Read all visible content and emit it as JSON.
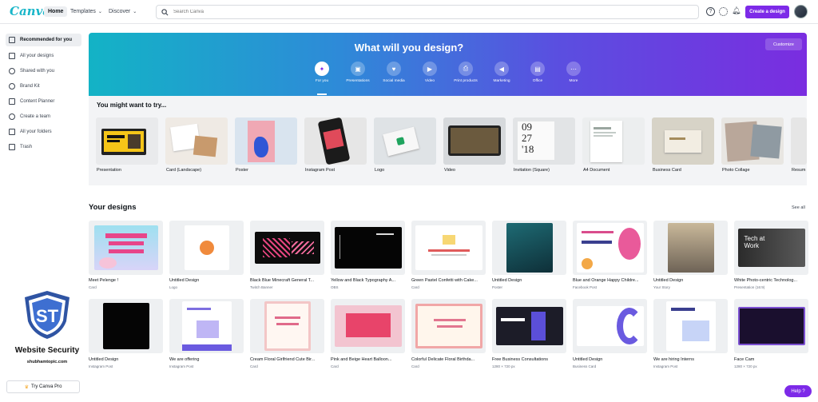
{
  "topnav": {
    "logo": "Canva",
    "home": "Home",
    "templates": "Templates",
    "discover": "Discover",
    "search_placeholder": "Search Canva",
    "create_label": "Create a design"
  },
  "sidebar": {
    "items": [
      {
        "label": "Recommended for you"
      },
      {
        "label": "All your designs"
      },
      {
        "label": "Shared with you"
      },
      {
        "label": "Brand Kit"
      },
      {
        "label": "Content Planner"
      },
      {
        "label": "Create a team"
      },
      {
        "label": "All your folders"
      },
      {
        "label": "Trash"
      }
    ],
    "pro_label": "Try Canva Pro"
  },
  "watermark": {
    "title": "Website Security",
    "subtitle": "shubhamtopic.com",
    "logo_text": "ST"
  },
  "hero": {
    "title": "What will you design?",
    "customize": "Customize",
    "categories": [
      {
        "label": "For you",
        "icon": "sparkle-icon"
      },
      {
        "label": "Presentations",
        "icon": "presentation-icon"
      },
      {
        "label": "Social media",
        "icon": "heart-icon"
      },
      {
        "label": "Video",
        "icon": "video-icon"
      },
      {
        "label": "Print products",
        "icon": "printer-icon"
      },
      {
        "label": "Marketing",
        "icon": "megaphone-icon"
      },
      {
        "label": "Office",
        "icon": "briefcase-icon"
      },
      {
        "label": "More",
        "icon": "more-icon"
      }
    ]
  },
  "suggestions": {
    "title": "You might want to try...",
    "items": [
      {
        "label": "Presentation"
      },
      {
        "label": "Card (Landscape)"
      },
      {
        "label": "Poster"
      },
      {
        "label": "Instagram Post"
      },
      {
        "label": "Logo"
      },
      {
        "label": "Video"
      },
      {
        "label": "Invitation (Square)"
      },
      {
        "label": "A4 Document"
      },
      {
        "label": "Business Card"
      },
      {
        "label": "Photo Collage"
      },
      {
        "label": "Resum"
      }
    ]
  },
  "designs": {
    "title": "Your designs",
    "see_all": "See all",
    "items": [
      {
        "title": "Meet Pelenge !",
        "type": "Card"
      },
      {
        "title": "Untitled Design",
        "type": "Logo"
      },
      {
        "title": "Black Blue Minecraft General T...",
        "type": "Twitch Banner"
      },
      {
        "title": "Yellow and Black Typography A...",
        "type": "OBS"
      },
      {
        "title": "Green Pastel Confetti with Cake...",
        "type": "Card"
      },
      {
        "title": "Untitled Design",
        "type": "Poster"
      },
      {
        "title": "Blue and Orange Happy Childre...",
        "type": "Facebook Post"
      },
      {
        "title": "Untitled Design",
        "type": "Your Story"
      },
      {
        "title": "White Photo-centric Technolog...",
        "type": "Presentation (16:9)"
      },
      {
        "title": "Untitled Design",
        "type": "Instagram Post"
      },
      {
        "title": "We are offering",
        "type": "Instagram Post"
      },
      {
        "title": "Cream Floral Girlfriend Cute Bir...",
        "type": "Card"
      },
      {
        "title": "Pink and Beige Heart Balloon...",
        "type": "Card"
      },
      {
        "title": "Colorful Delicate Floral Birthda...",
        "type": "Card"
      },
      {
        "title": "Free Business Consultations",
        "type": "1280 × 720 px"
      },
      {
        "title": "Untitled Design",
        "type": "Business Card"
      },
      {
        "title": "We are hiring Interns",
        "type": "Instagram Post"
      },
      {
        "title": "Face Cam",
        "type": "1280 × 720 px"
      }
    ]
  },
  "help": "Help ?"
}
